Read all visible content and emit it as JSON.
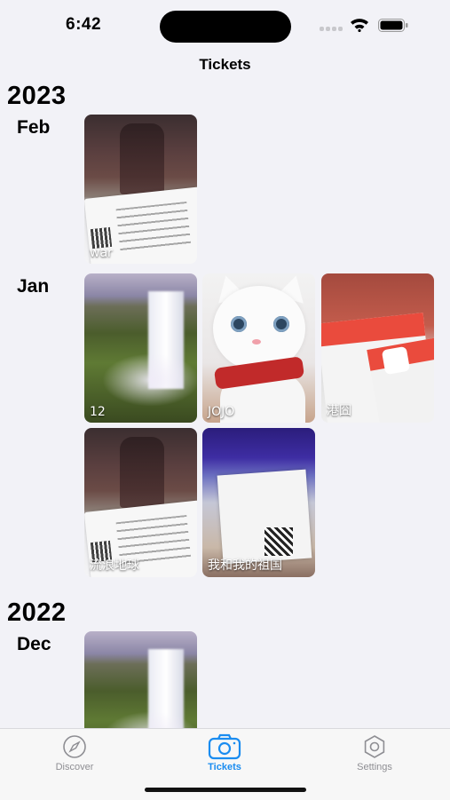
{
  "status_bar": {
    "time": "6:42"
  },
  "nav": {
    "title": "Tickets"
  },
  "sections": [
    {
      "year": "2023",
      "months": [
        {
          "month": "Feb",
          "items": [
            {
              "caption": "war",
              "image": "movie-ticket-photo"
            }
          ]
        },
        {
          "month": "Jan",
          "items": [
            {
              "caption": "12",
              "image": "waterfall-photo"
            },
            {
              "caption": "JOJO",
              "image": "white-cat-photo"
            },
            {
              "caption": "港囧",
              "image": "maoyan-ticket-photo"
            },
            {
              "caption": "流浪地球",
              "image": "movie-ticket-photo"
            },
            {
              "caption": "我和我的祖国",
              "image": "cinema-tickets-photo"
            }
          ]
        }
      ]
    },
    {
      "year": "2022",
      "months": [
        {
          "month": "Dec",
          "items": [
            {
              "caption": "",
              "image": "waterfall-photo"
            }
          ]
        }
      ]
    }
  ],
  "tabbar": {
    "tabs": [
      {
        "label": "Discover",
        "icon": "compass-icon",
        "active": false
      },
      {
        "label": "Tickets",
        "icon": "camera-icon",
        "active": true
      },
      {
        "label": "Settings",
        "icon": "hexagon-gear-icon",
        "active": false
      }
    ]
  },
  "colors": {
    "accent": "#1a8cf0",
    "inactive": "#8e8e93",
    "background": "#f2f2f7"
  }
}
